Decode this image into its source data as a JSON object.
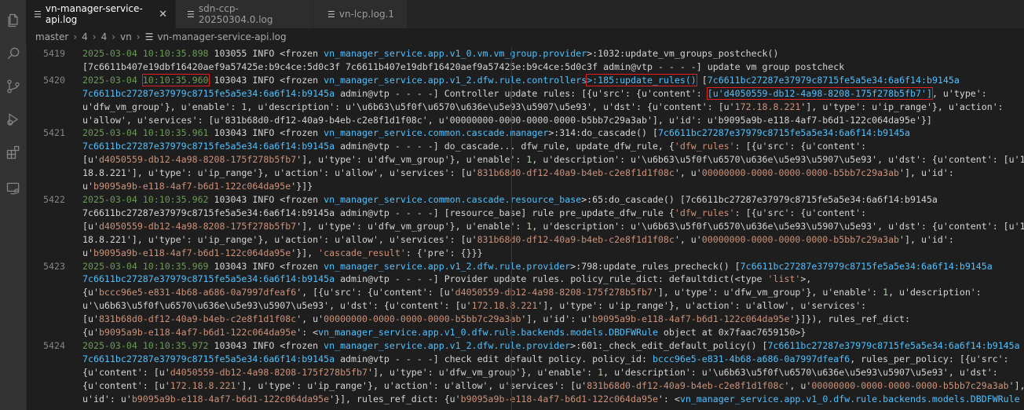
{
  "tabs": [
    {
      "label": "vn-manager-service-api.log",
      "active": true,
      "icon": "list-icon",
      "close": "✕"
    },
    {
      "label": "sdn-ccp-20250304.0.log",
      "active": false,
      "icon": "list-icon"
    },
    {
      "label": "vn-lcp.log.1",
      "active": false,
      "icon": "list-icon"
    }
  ],
  "breadcrumb": [
    "master",
    "4",
    "4",
    "vn",
    "vn-manager-service-api.log"
  ],
  "activity_icons": [
    "files-icon",
    "search-icon",
    "source-control-icon",
    "run-debug-icon",
    "extensions-icon",
    "remote-explorer-icon"
  ],
  "colors": {
    "timestamp": "#6a9955",
    "module": "#4fc1ff",
    "string": "#ce9178",
    "number": "#b5cea8",
    "highlight_box": "#e51f1f"
  },
  "lines": [
    {
      "no": "5419",
      "rows": [
        [
          [
            "ts",
            "2025-03-04 10:10:35.898"
          ],
          [
            "t",
            " 103055 INFO <frozen "
          ],
          [
            "p",
            "vn_manager_service.app.v1_0.vm.vm_group.provider"
          ],
          [
            "t",
            ">:1032:update_vm_groups_postcheck()"
          ]
        ],
        [
          [
            "t",
            "[7c6611b407e19dbf16420aef9a57425e:b9c4ce:5d0c3f 7c6611b407e19dbf16420aef9a57425e:b9c4ce:5d0c3f admin@vtp - - - -] update vm group postcheck"
          ]
        ]
      ]
    },
    {
      "no": "5420",
      "rows": [
        [
          [
            "ts",
            "2025-03-04 "
          ],
          [
            "tsh",
            "10:10:35.960"
          ],
          [
            "t",
            " 103043 INFO <frozen "
          ],
          [
            "p",
            "vn_manager_service.app.v1_2.dfw.rule.controllers"
          ],
          [
            "h",
            ">:185:update_rules()"
          ],
          [
            "t",
            " ["
          ],
          [
            "p",
            "7c6611bc27287e37979c8715fe5a5e34:6a6f14:b9145a"
          ]
        ],
        [
          [
            "p",
            "7c6611bc27287e37979c8715fe5a5e34:6a6f14:b9145a"
          ],
          [
            "t",
            " admin@vtp - - - -] Controller update rules: [{u'src': {u'content': "
          ],
          [
            "h2",
            "[u'd4050559-db12-4a98-8208-175f278b5fb7']"
          ],
          [
            "t",
            ", u'type':"
          ]
        ],
        [
          [
            "t",
            "u'dfw_vm_group'}, u'enable': "
          ],
          [
            "n",
            "1"
          ],
          [
            "t",
            ", u'description': u'\\u6b63\\u5f0f\\u6570\\u636e\\u5e93\\u5907\\u5e93', u'dst': {u'content': [u'"
          ],
          [
            "s",
            "172.18.8.221"
          ],
          [
            "t",
            "'], u'type': u'ip_range'}, u'action':"
          ]
        ],
        [
          [
            "t",
            "u'allow', u'services': [u'831b68d0-df12-40a9-b4eb-c2e8f1d1f08c', u'00000000-0000-0000-0000-b5bb7c29a3ab'], u'id': u'b9095a9b-e118-4af7-b6d1-122c064da95e'}]"
          ]
        ]
      ]
    },
    {
      "no": "5421",
      "rows": [
        [
          [
            "ts",
            "2025-03-04 10:10:35.961"
          ],
          [
            "t",
            " 103043 INFO <frozen "
          ],
          [
            "p",
            "vn_manager_service.common.cascade.manager"
          ],
          [
            "t",
            ">:314:do_cascade() ["
          ],
          [
            "p",
            "7c6611bc27287e37979c8715fe5a5e34:6a6f14:b9145a"
          ]
        ],
        [
          [
            "p",
            "7c6611bc27287e37979c8715fe5a5e34:6a6f14:b9145a"
          ],
          [
            "t",
            " admin@vtp - - - -] do_cascade... dfw_rule, update_dfw_rule, {"
          ],
          [
            "s",
            "'dfw_rules'"
          ],
          [
            "t",
            ": [{u'src': {u'content':"
          ]
        ],
        [
          [
            "t",
            "[u'"
          ],
          [
            "s",
            "d4050559-db12-4a98-8208-175f278b5fb7"
          ],
          [
            "t",
            "'], u'type': u'dfw_vm_group'}, u'enable': "
          ],
          [
            "n",
            "1"
          ],
          [
            "t",
            ", u'description': u'\\u6b63\\u5f0f\\u6570\\u636e\\u5e93\\u5907\\u5e93', u'dst': {u'content': [u'172."
          ]
        ],
        [
          [
            "t",
            "18.8.221'], u'type': u'ip_range'}, u'action': u'allow', u'services': [u'"
          ],
          [
            "s",
            "831b68d0-df12-40a9-b4eb-c2e8f1d1f08c"
          ],
          [
            "t",
            "', u'"
          ],
          [
            "s",
            "00000000-0000-0000-0000-b5bb7c29a3ab"
          ],
          [
            "t",
            "'], u'id':"
          ]
        ],
        [
          [
            "t",
            "u'"
          ],
          [
            "s",
            "b9095a9b-e118-4af7-b6d1-122c064da95e"
          ],
          [
            "t",
            "'}]}"
          ]
        ]
      ]
    },
    {
      "no": "5422",
      "rows": [
        [
          [
            "ts",
            "2025-03-04 10:10:35.962"
          ],
          [
            "t",
            " 103043 INFO <frozen "
          ],
          [
            "p",
            "vn_manager_service.common.cascade.resource_base"
          ],
          [
            "t",
            ">:65:do_cascade() [7c6611bc27287e37979c8715fe5a5e34:6a6f14:b9145a"
          ]
        ],
        [
          [
            "t",
            "7c6611bc27287e37979c8715fe5a5e34:6a6f14:b9145a admin@vtp - - - -] [resource_base] rule pre_update_dfw_rule {"
          ],
          [
            "s",
            "'dfw_rules'"
          ],
          [
            "t",
            ": [{u'src': {u'content':"
          ]
        ],
        [
          [
            "t",
            "[u'"
          ],
          [
            "s",
            "d4050559-db12-4a98-8208-175f278b5fb7"
          ],
          [
            "t",
            "'], u'type': u'dfw_vm_group'}, u'enable': "
          ],
          [
            "n",
            "1"
          ],
          [
            "t",
            ", u'description': u'\\u6b63\\u5f0f\\u6570\\u636e\\u5e93\\u5907\\u5e93', u'dst': {u'content': [u'172."
          ]
        ],
        [
          [
            "t",
            "18.8.221'], u'type': u'ip_range'}, u'action': u'allow', u'services': [u'"
          ],
          [
            "s",
            "831b68d0-df12-40a9-b4eb-c2e8f1d1f08c"
          ],
          [
            "t",
            "', u'"
          ],
          [
            "s",
            "00000000-0000-0000-0000-b5bb7c29a3ab"
          ],
          [
            "t",
            "'], u'id':"
          ]
        ],
        [
          [
            "t",
            "u'"
          ],
          [
            "s",
            "b9095a9b-e118-4af7-b6d1-122c064da95e"
          ],
          [
            "t",
            "'}], "
          ],
          [
            "s",
            "'cascade_result'"
          ],
          [
            "t",
            ": {'pre': {}}}"
          ]
        ]
      ]
    },
    {
      "no": "5423",
      "rows": [
        [
          [
            "ts",
            "2025-03-04 10:10:35.969"
          ],
          [
            "t",
            " 103043 INFO <frozen "
          ],
          [
            "p",
            "vn_manager_service.app.v1_2.dfw.rule.provider"
          ],
          [
            "t",
            ">:798:update_rules_precheck() ["
          ],
          [
            "p",
            "7c6611bc27287e37979c8715fe5a5e34:6a6f14:b9145a"
          ]
        ],
        [
          [
            "p",
            "7c6611bc27287e37979c8715fe5a5e34:6a6f14:b9145a"
          ],
          [
            "t",
            " admin@vtp - - - -] Provider update rules. policy_rule_dict: defaultdict(<type "
          ],
          [
            "s",
            "'list'"
          ],
          [
            "t",
            ">,"
          ]
        ],
        [
          [
            "t",
            "{u'"
          ],
          [
            "s",
            "bccc96e5-e831-4b68-a686-0a7997dfeaf6"
          ],
          [
            "t",
            "', [{u'src': {u'content': [u'"
          ],
          [
            "s",
            "d4050559-db12-4a98-8208-175f278b5fb7"
          ],
          [
            "t",
            "'], u'type': u'dfw_vm_group'}, u'enable': "
          ],
          [
            "n",
            "1"
          ],
          [
            "t",
            ", u'description':"
          ]
        ],
        [
          [
            "t",
            "u'\\u6b63\\u5f0f\\u6570\\u636e\\u5e93\\u5907\\u5e93', u'dst': {u'content': [u'"
          ],
          [
            "s",
            "172.18.8.221"
          ],
          [
            "t",
            "'], u'type': u'ip_range'}, u'action': u'allow', u'services':"
          ]
        ],
        [
          [
            "t",
            "[u'"
          ],
          [
            "s",
            "831b68d0-df12-40a9-b4eb-c2e8f1d1f08c"
          ],
          [
            "t",
            "', u'"
          ],
          [
            "s",
            "00000000-0000-0000-0000-b5bb7c29a3ab"
          ],
          [
            "t",
            "'], u'id': u'"
          ],
          [
            "s",
            "b9095a9b-e118-4af7-b6d1-122c064da95e"
          ],
          [
            "t",
            "'}]}), rules_ref_dict:"
          ]
        ],
        [
          [
            "t",
            "{u'"
          ],
          [
            "s",
            "b9095a9b-e118-4af7-b6d1-122c064da95e"
          ],
          [
            "t",
            "': <"
          ],
          [
            "p",
            "vn_manager_service.app.v1_0.dfw.rule.backends.models.DBDFWRule"
          ],
          [
            "t",
            " object at 0x7faac7659150>}"
          ]
        ]
      ]
    },
    {
      "no": "5424",
      "rows": [
        [
          [
            "ts",
            "2025-03-04 10:10:35.972"
          ],
          [
            "t",
            " 103043 INFO <frozen "
          ],
          [
            "p",
            "vn_manager_service.app.v1_2.dfw.rule.provider"
          ],
          [
            "t",
            ">:601:_check_edit_default_policy() ["
          ],
          [
            "p",
            "7c6611bc27287e37979c8715fe5a5e34:6a6f14:b9145a"
          ]
        ],
        [
          [
            "p",
            "7c6611bc27287e37979c8715fe5a5e34:6a6f14:b9145a"
          ],
          [
            "t",
            " admin@vtp - - - -] check edit default policy. policy_id: "
          ],
          [
            "p",
            "bccc96e5-e831-4b68-a686-0a7997dfeaf6"
          ],
          [
            "t",
            ", rules_per_policy: [{u'src':"
          ]
        ],
        [
          [
            "t",
            "{u'content': [u'"
          ],
          [
            "s",
            "d4050559-db12-4a98-8208-175f278b5fb7"
          ],
          [
            "t",
            "'], u'type': u'dfw_vm_group'}, u'enable': "
          ],
          [
            "n",
            "1"
          ],
          [
            "t",
            ", u'description': u'\\u6b63\\u5f0f\\u6570\\u636e\\u5e93\\u5907\\u5e93', u'dst':"
          ]
        ],
        [
          [
            "t",
            "{u'content': [u'"
          ],
          [
            "s",
            "172.18.8.221"
          ],
          [
            "t",
            "'], u'type': u'ip_range'}, u'action': u'allow', u'services': [u'"
          ],
          [
            "s",
            "831b68d0-df12-40a9-b4eb-c2e8f1d1f08c"
          ],
          [
            "t",
            "', u'"
          ],
          [
            "s",
            "00000000-0000-0000-0000-b5bb7c29a3ab"
          ],
          [
            "t",
            "'],"
          ]
        ],
        [
          [
            "t",
            "u'id': u'"
          ],
          [
            "s",
            "b9095a9b-e118-4af7-b6d1-122c064da95e"
          ],
          [
            "t",
            "'}], rules_ref_dict: {u'"
          ],
          [
            "s",
            "b9095a9b-e118-4af7-b6d1-122c064da95e"
          ],
          [
            "t",
            "': <"
          ],
          [
            "p",
            "vn_manager_service.app.v1_0.dfw.rule.backends.models.DBDFWRule"
          ]
        ]
      ]
    }
  ]
}
